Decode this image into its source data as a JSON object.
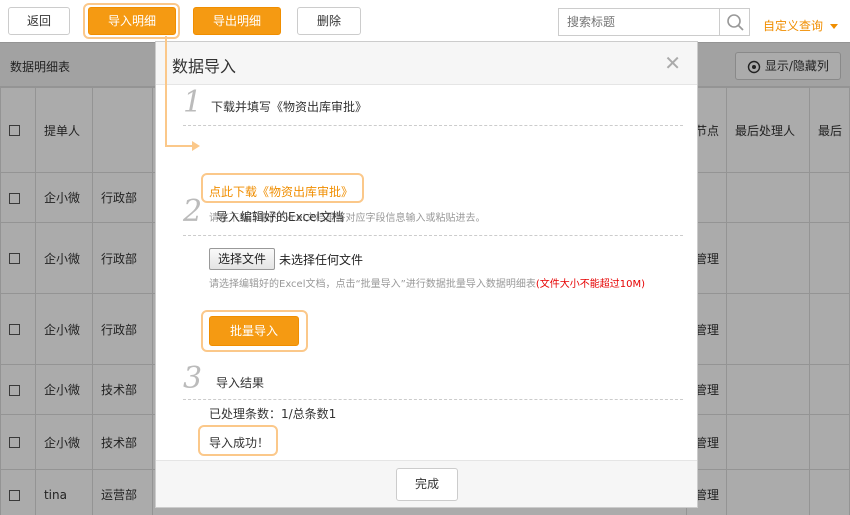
{
  "toolbar": {
    "back_label": "返回",
    "import_label": "导入明细",
    "export_label": "导出明细",
    "delete_label": "删除",
    "search_placeholder": "搜索标题",
    "custom_query_label": "自定义查询"
  },
  "section": {
    "title": "数据明细表",
    "toggle_columns_label": "显示/隐藏列"
  },
  "table": {
    "headers": [
      "",
      "提单人",
      "",
      "",
      "",
      "",
      "",
      "",
      "节点",
      "最后处理人",
      "最后"
    ],
    "rows": [
      {
        "submitter": "企小微",
        "dept": "",
        "node": ""
      },
      {
        "submitter": "企小微",
        "dept": "行政部",
        "node": "管理"
      },
      {
        "submitter": "企小微",
        "dept": "行政部",
        "node": "管理"
      },
      {
        "submitter": "企小微",
        "dept": "技术部",
        "node": "管理"
      },
      {
        "submitter": "企小微",
        "dept": "技术部",
        "node": "管理"
      },
      {
        "submitter": "tina",
        "dept": "运营部",
        "node": "管理"
      }
    ],
    "first_row_dept": "行政部"
  },
  "modal": {
    "title": "数据导入",
    "step1": {
      "num": "1",
      "text": "下载并填写《物资出库审批》",
      "link": "点此下载《物资出库审批》",
      "hint": "请在下载下来的Excel文档里将对应字段信息输入或粘贴进去。"
    },
    "step2": {
      "num": "2",
      "text": "导入编辑好的Excel文档",
      "file_button": "选择文件",
      "file_status": "未选择任何文件",
      "hint_part1": "请选择编辑好的Excel文档，点击“批量导入”进行数据批量导入数据明细表",
      "hint_warn": "(文件大小不能超过10M)",
      "import_button": "批量导入"
    },
    "step3": {
      "num": "3",
      "text": "导入结果",
      "processed": "已处理条数：1/总条数1",
      "success": "导入成功！"
    },
    "done_label": "完成"
  },
  "colors": {
    "accent": "#f59a12",
    "highlight_ring": "#fbc88a",
    "warning": "#e60000"
  },
  "icons": [
    "search-icon",
    "close-icon",
    "caret-down-icon",
    "eye-icon",
    "arrow-icon"
  ]
}
